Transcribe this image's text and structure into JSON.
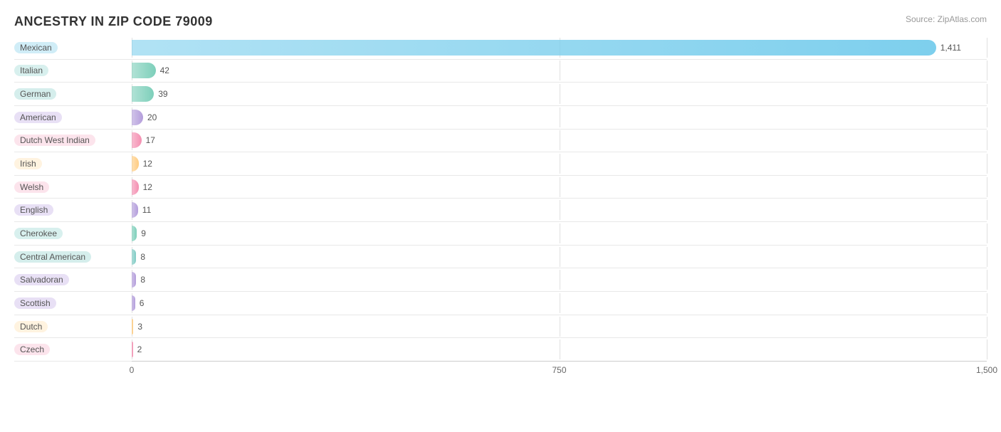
{
  "title": "ANCESTRY IN ZIP CODE 79009",
  "source": "Source: ZipAtlas.com",
  "max_value": 1500,
  "x_ticks": [
    {
      "label": "0",
      "pct": 0
    },
    {
      "label": "750",
      "pct": 50
    },
    {
      "label": "1,500",
      "pct": 100
    }
  ],
  "bars": [
    {
      "label": "Mexican",
      "value": 1411,
      "color_bg": "#a8d8ea",
      "color_fill": "#6ec6e6",
      "pill_bg": "#d0edf7",
      "pill_color": "#555"
    },
    {
      "label": "Italian",
      "value": 42,
      "color_bg": "#c8e6c9",
      "color_fill": "#80cbc4",
      "pill_bg": "#d8f0ee",
      "pill_color": "#555"
    },
    {
      "label": "German",
      "value": 39,
      "color_bg": "#b2dfdb",
      "color_fill": "#80cbc4",
      "pill_bg": "#d5eeec",
      "pill_color": "#555"
    },
    {
      "label": "American",
      "value": 20,
      "color_bg": "#d1c4e9",
      "color_fill": "#b39ddb",
      "pill_bg": "#e8e0f5",
      "pill_color": "#555"
    },
    {
      "label": "Dutch West Indian",
      "value": 17,
      "color_bg": "#f8bbd0",
      "color_fill": "#f48fb1",
      "pill_bg": "#fce4ec",
      "pill_color": "#555"
    },
    {
      "label": "Irish",
      "value": 12,
      "color_bg": "#ffe0b2",
      "color_fill": "#ffcc80",
      "pill_bg": "#fff3e0",
      "pill_color": "#555"
    },
    {
      "label": "Welsh",
      "value": 12,
      "color_bg": "#f8bbd0",
      "color_fill": "#f48fb1",
      "pill_bg": "#fce4ec",
      "pill_color": "#555"
    },
    {
      "label": "English",
      "value": 11,
      "color_bg": "#d1c4e9",
      "color_fill": "#b39ddb",
      "pill_bg": "#e8e0f5",
      "pill_color": "#555"
    },
    {
      "label": "Cherokee",
      "value": 9,
      "color_bg": "#c8e6c9",
      "color_fill": "#80cbc4",
      "pill_bg": "#d8f0ee",
      "pill_color": "#555"
    },
    {
      "label": "Central American",
      "value": 8,
      "color_bg": "#b2dfdb",
      "color_fill": "#80cbc4",
      "pill_bg": "#d5eeec",
      "pill_color": "#555"
    },
    {
      "label": "Salvadoran",
      "value": 8,
      "color_bg": "#d1c4e9",
      "color_fill": "#b39ddb",
      "pill_bg": "#e8e0f5",
      "pill_color": "#555"
    },
    {
      "label": "Scottish",
      "value": 6,
      "color_bg": "#d1c4e9",
      "color_fill": "#b39ddb",
      "pill_bg": "#e8e0f5",
      "pill_color": "#555"
    },
    {
      "label": "Dutch",
      "value": 3,
      "color_bg": "#ffe0b2",
      "color_fill": "#ffcc80",
      "pill_bg": "#fff3e0",
      "pill_color": "#555"
    },
    {
      "label": "Czech",
      "value": 2,
      "color_bg": "#f8bbd0",
      "color_fill": "#f48fb1",
      "pill_bg": "#fce4ec",
      "pill_color": "#555"
    }
  ]
}
